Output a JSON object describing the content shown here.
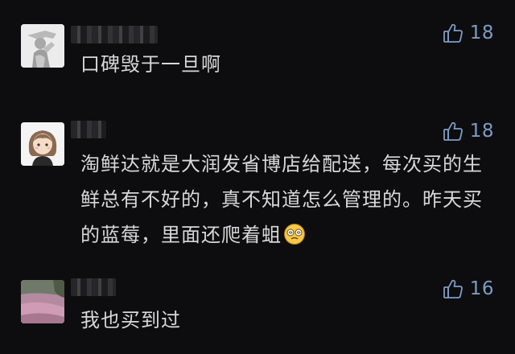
{
  "comments": [
    {
      "avatar_icon": "statue-avatar",
      "text": "口碑毁于一旦啊",
      "likes": "18"
    },
    {
      "avatar_icon": "cartoon-girl-avatar",
      "text": "淘鲜达就是大润发省博店给配送，每次买的生鲜总有不好的，真不知道怎么管理的。昨天买的蓝莓，里面还爬着蛆",
      "emoji": "dizzy-face-emoji",
      "likes": "18"
    },
    {
      "avatar_icon": "landscape-avatar",
      "text": "我也买到过",
      "likes": "16"
    }
  ],
  "colors": {
    "background": "#0d0d0f",
    "text": "#d8d8d8",
    "like_accent": "#7e9cc4"
  }
}
